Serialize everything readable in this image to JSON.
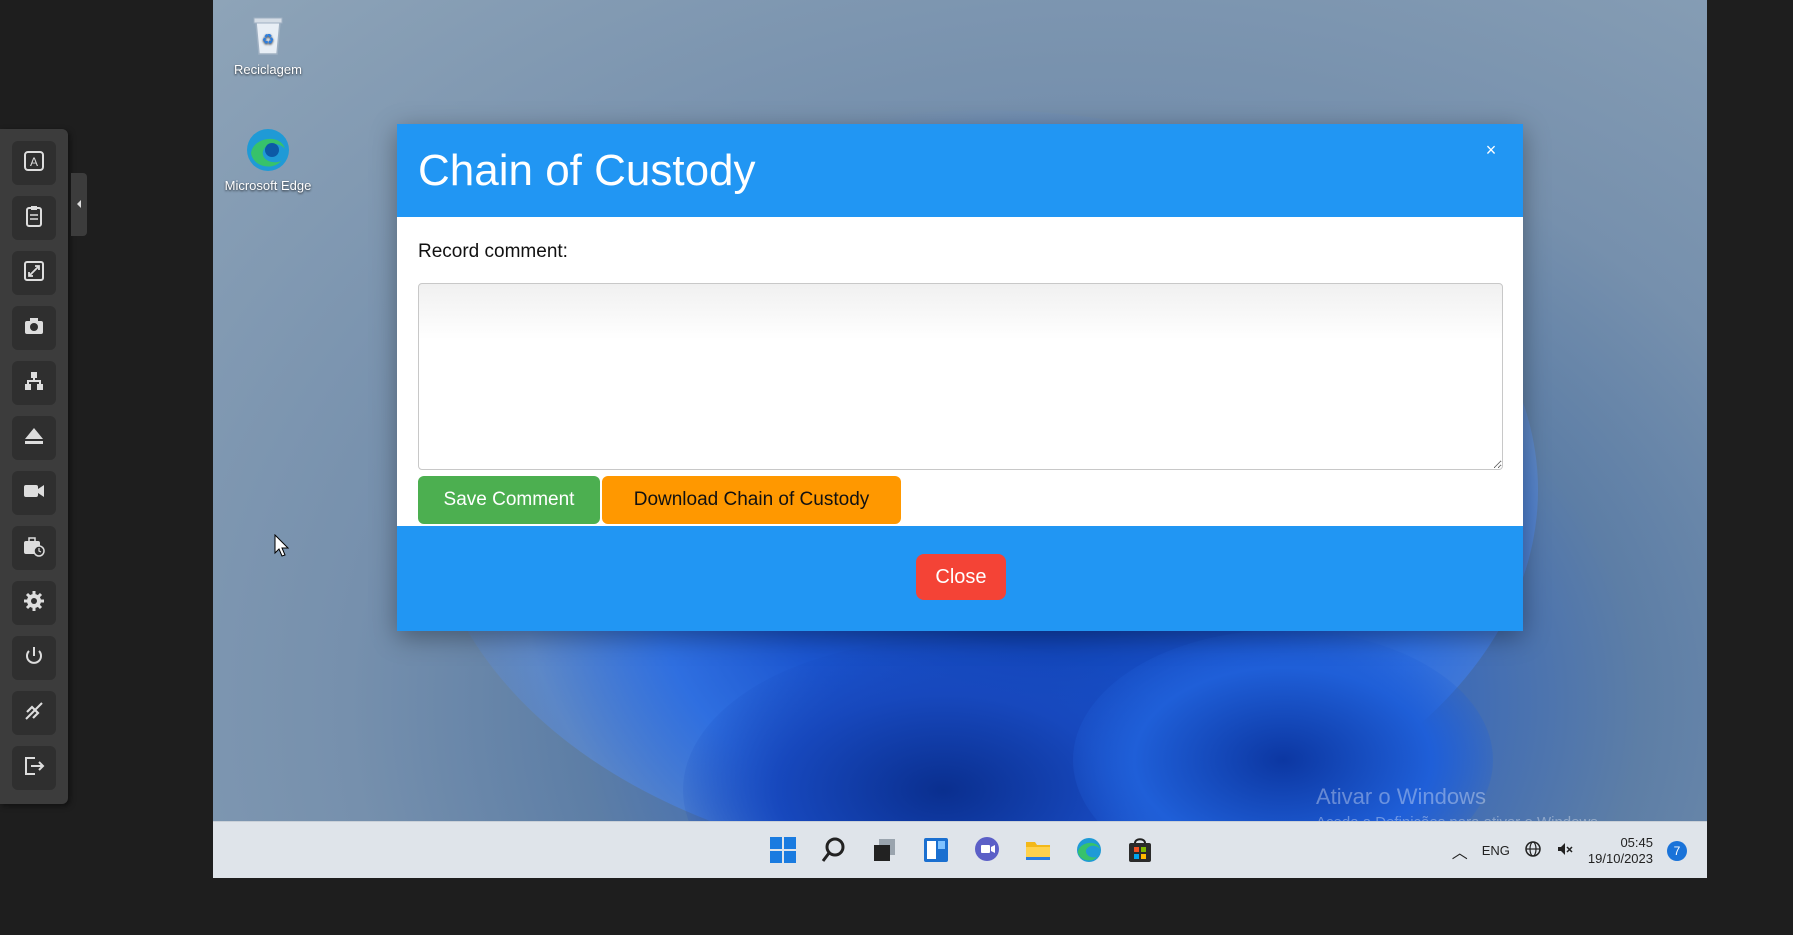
{
  "desktop": {
    "icons": [
      {
        "label": "Reciclagem",
        "icon": "recycle-bin-icon"
      },
      {
        "label": "Microsoft Edge",
        "icon": "edge-icon"
      }
    ],
    "watermark": {
      "line1": "Ativar o Windows",
      "line2": "Aceda a Definições para ativar o Windows."
    }
  },
  "toolbar": {
    "tools": [
      {
        "name": "keyboard-tool",
        "icon": "keyboard-a-icon"
      },
      {
        "name": "clipboard-tool",
        "icon": "clipboard-icon"
      },
      {
        "name": "fullscreen-tool",
        "icon": "expand-icon"
      },
      {
        "name": "screenshot-tool",
        "icon": "camera-icon"
      },
      {
        "name": "network-tool",
        "icon": "network-icon"
      },
      {
        "name": "eject-tool",
        "icon": "eject-icon"
      },
      {
        "name": "record-tool",
        "icon": "video-camera-icon"
      },
      {
        "name": "case-history-tool",
        "icon": "briefcase-clock-icon"
      },
      {
        "name": "settings-tool",
        "icon": "gear-icon"
      },
      {
        "name": "power-tool",
        "icon": "power-icon"
      },
      {
        "name": "disconnect-tool",
        "icon": "unlink-icon"
      },
      {
        "name": "logout-tool",
        "icon": "logout-icon"
      }
    ]
  },
  "modal": {
    "title": "Chain of Custody",
    "close_x": "×",
    "label": "Record comment:",
    "comment_value": "",
    "save_label": "Save Comment",
    "download_label": "Download Chain of Custody",
    "close_label": "Close",
    "colors": {
      "header": "#2196f3",
      "save": "#4caf50",
      "download": "#ff9800",
      "close": "#f44336"
    }
  },
  "taskbar": {
    "apps": [
      "start-icon",
      "search-icon",
      "task-view-icon",
      "widgets-icon",
      "chat-icon",
      "file-explorer-icon",
      "edge-icon",
      "store-icon"
    ],
    "tray": {
      "language": "ENG",
      "time": "05:45",
      "date": "19/10/2023",
      "notifications": "7"
    }
  }
}
